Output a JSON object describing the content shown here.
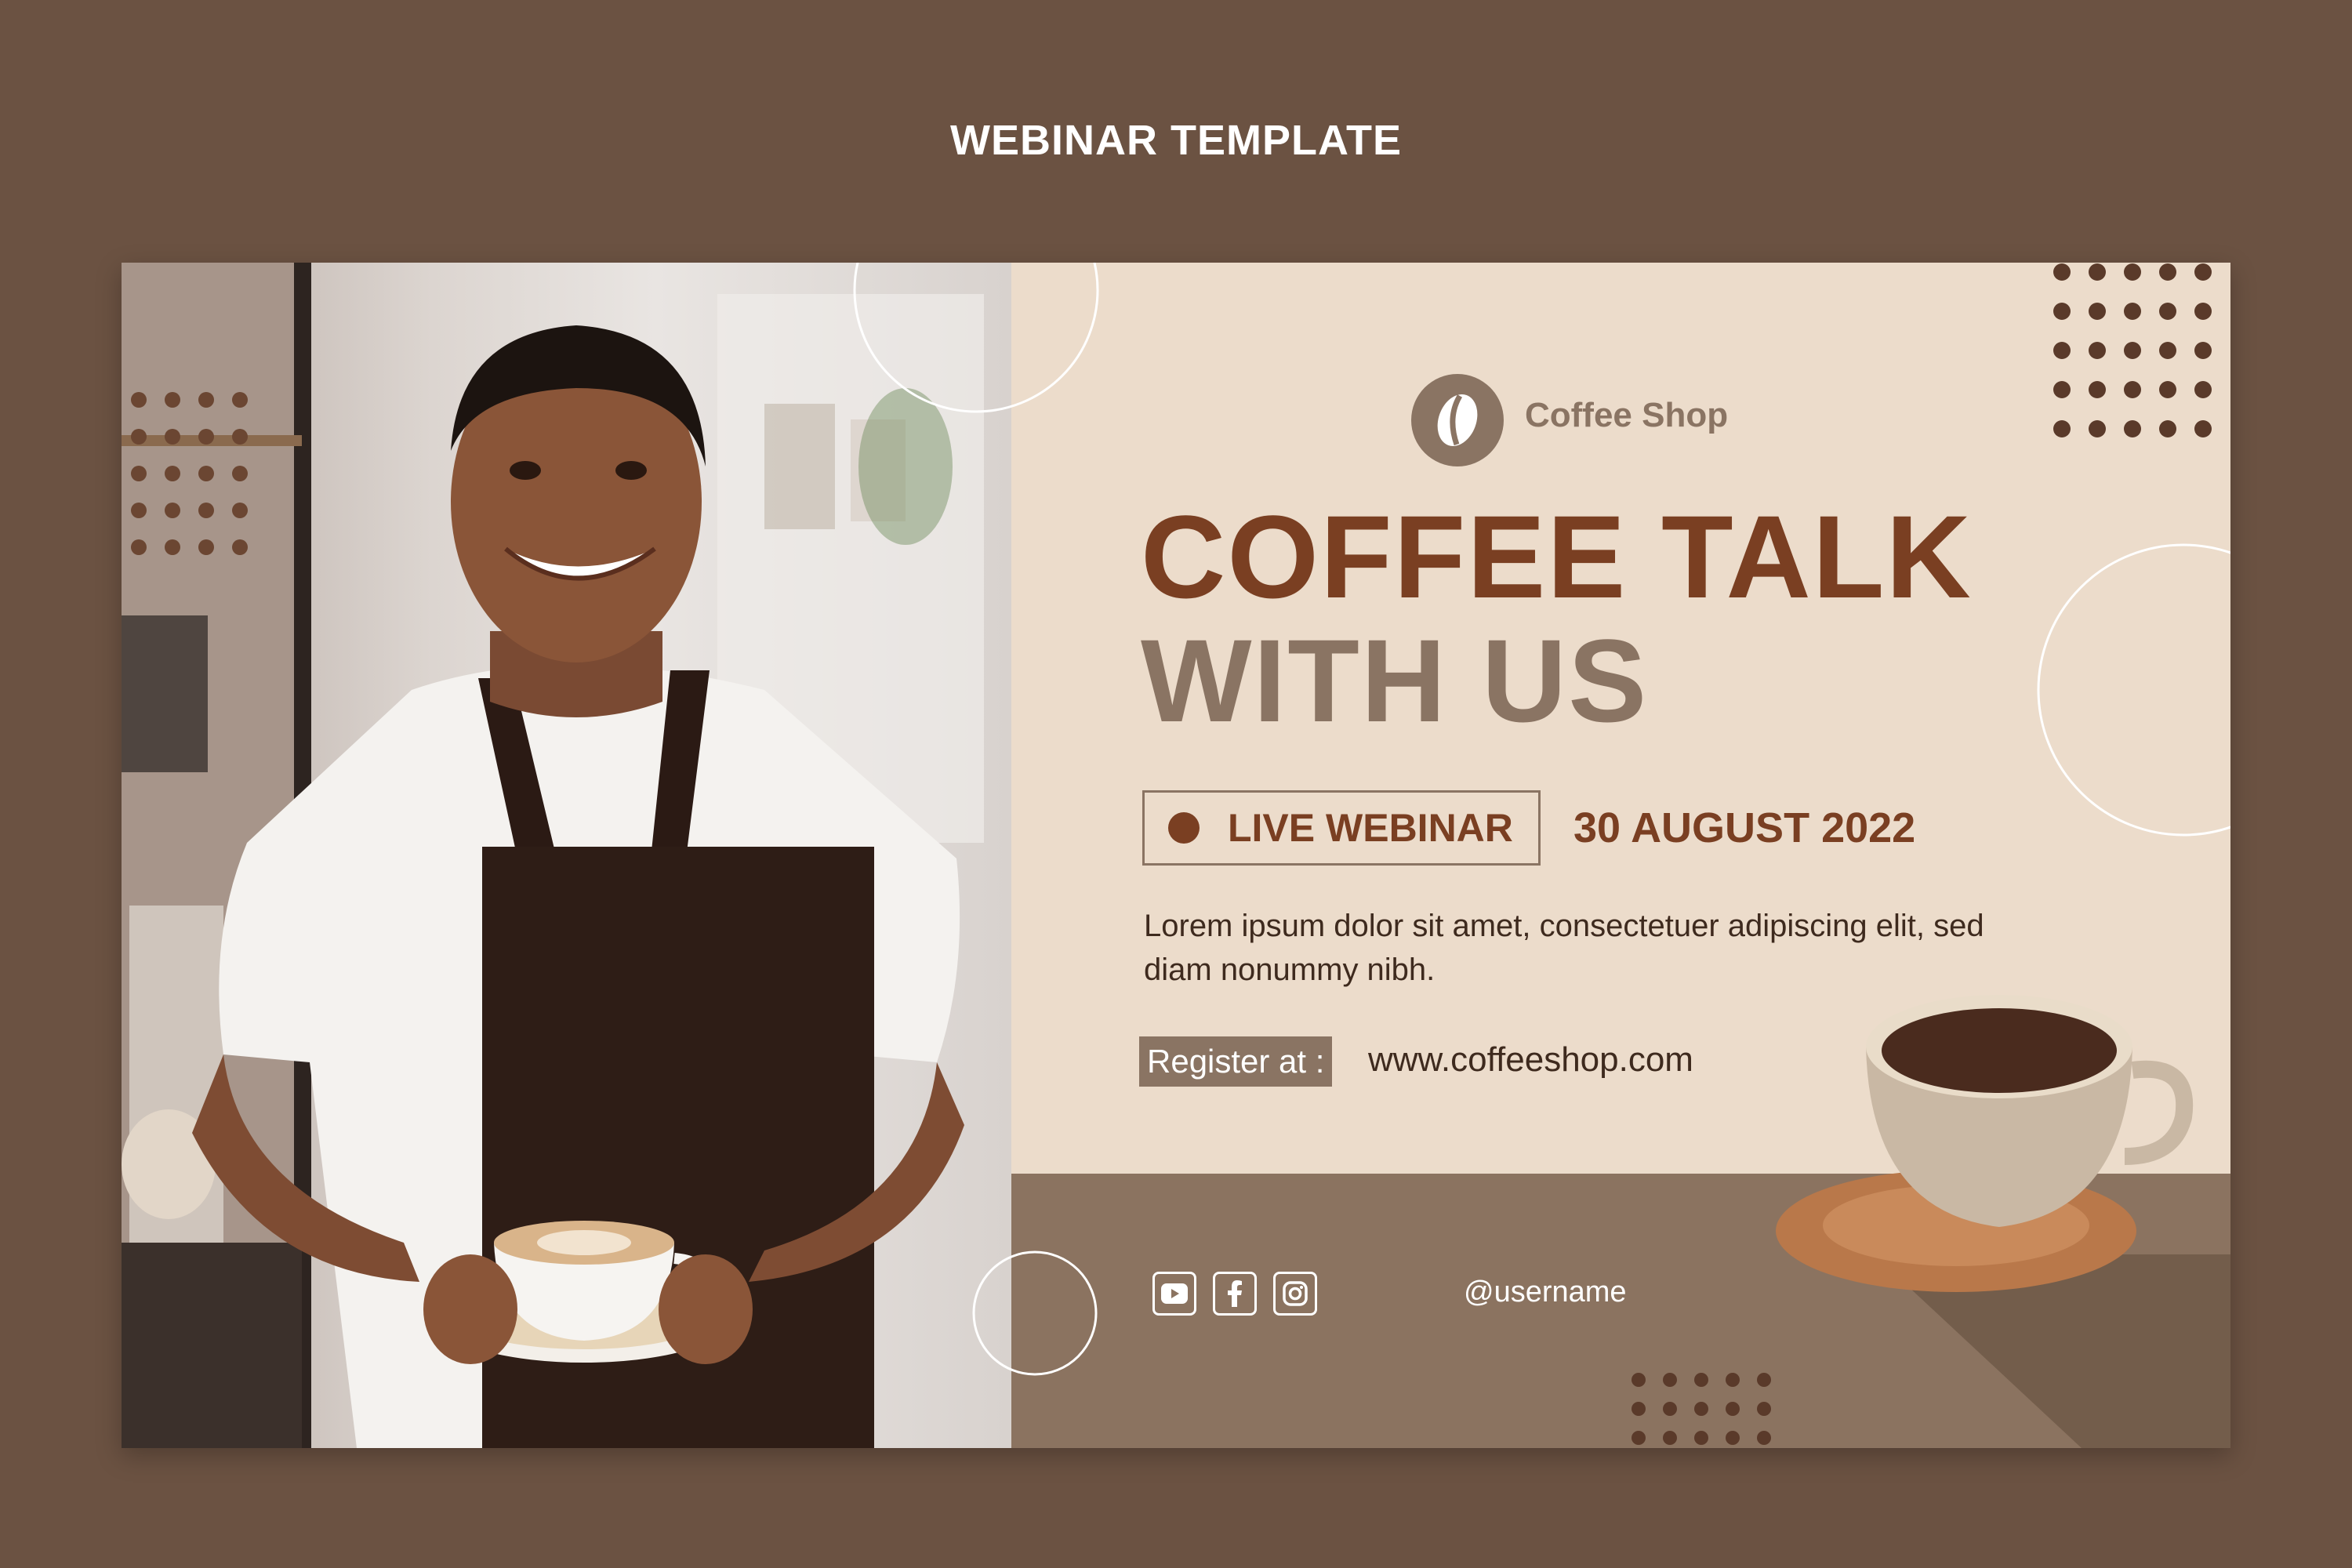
{
  "page": {
    "title": "WEBINAR TEMPLATE"
  },
  "brand": {
    "name": "Coffee Shop",
    "logo_icon": "coffee-bean-icon"
  },
  "headline": {
    "line1": "COFFEE TALK",
    "line2": "WITH US"
  },
  "event": {
    "badge_label": "LIVE WEBINAR",
    "date": "30 AUGUST 2022"
  },
  "description": "Lorem ipsum dolor sit amet, consectetuer adipiscing elit, sed diam nonummy nibh.",
  "register": {
    "label": "Register at :",
    "url": "www.coffeeshop.com"
  },
  "social": {
    "icons": [
      "youtube-icon",
      "facebook-icon",
      "instagram-icon"
    ],
    "username": "@username"
  },
  "colors": {
    "background": "#6b5242",
    "panel": "#ecdccb",
    "accent_dark": "#7a3f22",
    "accent_mid": "#8a7463",
    "band": "#8b7360"
  }
}
